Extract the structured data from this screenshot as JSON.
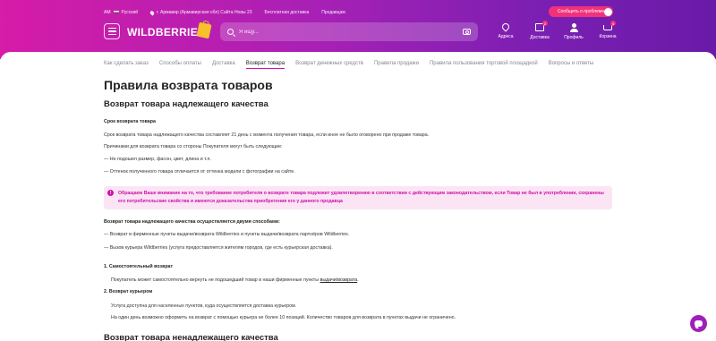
{
  "header": {
    "topbar": {
      "currency": "AM",
      "language": "Русский",
      "location": "г. Армавир (Армавирская обл) Сайта Новы 23",
      "free_delivery": "Бесплатная доставка",
      "sell": "Продавцам"
    },
    "problem_button": "Сообщить о проблеме",
    "logo": "WILDBERRIES",
    "search": {
      "placeholder": "Я ищу..."
    },
    "icons": [
      {
        "label": "Адреса",
        "icon": "map-pin-icon"
      },
      {
        "label": "Доставка",
        "icon": "delivery-box-icon",
        "badge": "2"
      },
      {
        "label": "Профиль",
        "icon": "user-icon"
      },
      {
        "label": "Корзина",
        "icon": "cart-icon",
        "badge": "4"
      }
    ],
    "colors": {
      "gradient_start": "#d61ca8",
      "gradient_end": "#6a1aa8",
      "accent": "#cb11ab",
      "problem_button": "#f2317b"
    }
  },
  "subnav": {
    "tabs": [
      "Как сделать заказ",
      "Способы оплаты",
      "Доставка",
      "Возврат товара",
      "Возврат денежных средств",
      "Правила продажи",
      "Правила пользования торговой площадкой",
      "Вопросы и ответы"
    ],
    "active": "Возврат товара"
  },
  "page": {
    "title": "Правила возврата товаров",
    "section1": {
      "title": "Возврат товара надлежащего качества",
      "term_heading": "Срок возврата товара",
      "term_text": "Срок возврата товара надлежащего качества составляет 21 день с момента получения товара, если иное не было оговорено при продаже товара.",
      "reasons_intro": "Причинами для возврата товара со стороны Покупателя могут быть следующие:",
      "reasons": [
        "— Не подошел размер, фасон, цвет, длина и т.п.",
        "— Оттенок полученного товара отличается от оттенка модели с фотографии на сайте."
      ],
      "notice": "Обращаем Ваше внимание на то, что требование потребителя о возврате товара подлежит удовлетворению в соответствии с действующим законодательством, если Товар не был в употреблении, сохранены его потребительские свойства и имеются доказательства приобретения его у данного продавца",
      "methods_heading": "Возврат товара надлежащего качества осуществляется двумя способами:",
      "methods": [
        "— Возврат в фирменные пункты выдачи/возврата Wildberries и пункты выдачи/возврата партнёров Wildberries.",
        "— Вызов курьера Wildberries (услуга предоставляется жителям городов, где есть курьерская доставка)."
      ],
      "self_return": {
        "heading": "1. Самостоятельный возврат",
        "text": "Покупатель может самостоятельно вернуть не подошедший товар в наши фирменные пункты ",
        "link": "выдачи/возврата",
        "end": "."
      },
      "courier_return": {
        "heading": "2. Возврат курьером",
        "line1": "Услуга доступна для населенных пунктов, куда осуществляется доставка курьером.",
        "line2": "На один день возможно оформить на возврат с помощью курьера не более 10 позиций. Количество товаров для возврата в пунктах выдачи не ограничено."
      }
    },
    "section2_title": "Возврат товара ненадлежащего качества"
  }
}
